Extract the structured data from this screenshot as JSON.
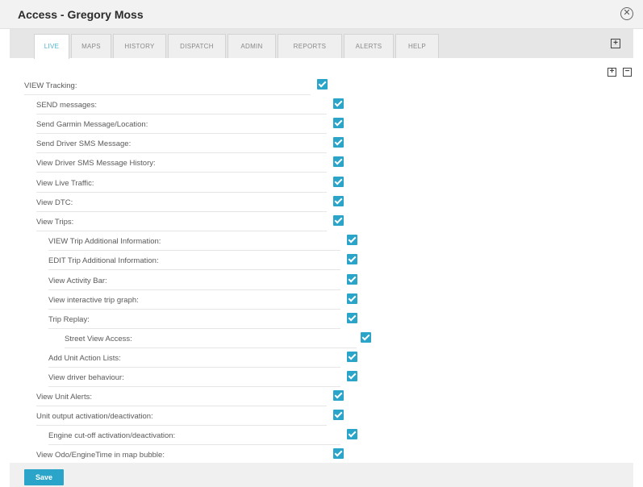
{
  "window": {
    "title": "Access - Gregory Moss"
  },
  "tabs": [
    {
      "label": "LIVE",
      "active": true
    },
    {
      "label": "MAPS"
    },
    {
      "label": "HISTORY"
    },
    {
      "label": "DISPATCH"
    },
    {
      "label": "ADMIN"
    },
    {
      "label": "REPORTS"
    },
    {
      "label": "ALERTS"
    },
    {
      "label": "HELP"
    }
  ],
  "icons": {
    "close": "close-circle-icon",
    "expand_tabs": "plus-square-icon",
    "expand_all": "plus-square-icon",
    "collapse_all": "minus-square-icon"
  },
  "colors": {
    "accent": "#2aa4c9",
    "active_tab_text": "#4cb3d4"
  },
  "permissions": [
    {
      "label": "VIEW Tracking:",
      "checked": true,
      "level": 0
    },
    {
      "label": "SEND messages:",
      "checked": true,
      "level": 1
    },
    {
      "label": "Send Garmin Message/Location:",
      "checked": true,
      "level": 1
    },
    {
      "label": "Send Driver SMS Message:",
      "checked": true,
      "level": 1
    },
    {
      "label": "View Driver SMS Message History:",
      "checked": true,
      "level": 1
    },
    {
      "label": "View Live Traffic:",
      "checked": true,
      "level": 1
    },
    {
      "label": "View DTC:",
      "checked": true,
      "level": 1
    },
    {
      "label": "View Trips:",
      "checked": true,
      "level": 1
    },
    {
      "label": "VIEW Trip Additional Information:",
      "checked": true,
      "level": 2
    },
    {
      "label": "EDIT Trip Additional Information:",
      "checked": true,
      "level": 2
    },
    {
      "label": "View Activity Bar:",
      "checked": true,
      "level": 2
    },
    {
      "label": "View interactive trip graph:",
      "checked": true,
      "level": 2
    },
    {
      "label": "Trip Replay:",
      "checked": true,
      "level": 2
    },
    {
      "label": "Street View Access:",
      "checked": true,
      "level": 3
    },
    {
      "label": "Add Unit Action Lists:",
      "checked": true,
      "level": 2
    },
    {
      "label": "View driver behaviour:",
      "checked": true,
      "level": 2
    },
    {
      "label": "View Unit Alerts:",
      "checked": true,
      "level": 1
    },
    {
      "label": "Unit output activation/deactivation:",
      "checked": true,
      "level": 1
    },
    {
      "label": "Engine cut-off activation/deactivation:",
      "checked": true,
      "level": 2
    },
    {
      "label": "View Odo/EngineTime in map bubble:",
      "checked": true,
      "level": 1
    }
  ],
  "footer": {
    "save_label": "Save"
  }
}
